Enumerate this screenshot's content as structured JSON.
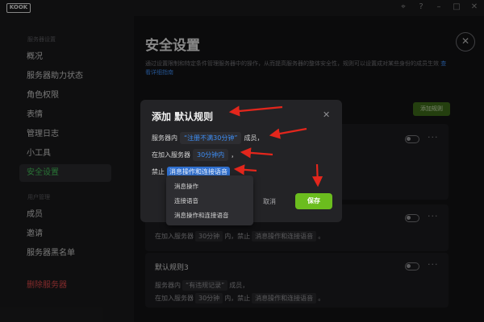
{
  "app": {
    "logo_text": "KOOK",
    "window_icons": [
      "pin-icon",
      "help-icon",
      "minimize-icon",
      "maximize-icon",
      "close-icon"
    ]
  },
  "sidebar": {
    "section_server_settings": "服务器设置",
    "items_top": [
      {
        "label": "概况"
      },
      {
        "label": "服务器助力状态"
      },
      {
        "label": "角色权限"
      },
      {
        "label": "表情"
      },
      {
        "label": "管理日志"
      },
      {
        "label": "小工具"
      },
      {
        "label": "安全设置",
        "active": true
      }
    ],
    "section_user_management": "用户管理",
    "items_bottom": [
      {
        "label": "成员"
      },
      {
        "label": "邀请"
      },
      {
        "label": "服务器黑名单"
      }
    ],
    "delete_server": "删除服务器"
  },
  "main": {
    "title": "安全设置",
    "description": "通过设置限制和特定条件管理服务器中的操作，从而提高服务器的整体安全性，规则可以设置成对某些身份的成员生效",
    "description_link": "查看详细指南",
    "add_rule_button": "添加规则",
    "rule_card_3": {
      "title": "默认规则3",
      "line1_prefix": "服务器内",
      "line1_pill": "“有违规记录”",
      "line1_suffix": "成员，",
      "line2_prefix": "在加入服务器",
      "line2_pill1": "30分钟",
      "line2_mid": "内，禁止",
      "line2_pill2": "消息操作和连接语音",
      "line2_suffix": "。"
    },
    "rule_card_2_partial": {
      "line2_prefix": "在加入服务器",
      "line2_pill1": "30分钟",
      "line2_mid": "内，禁止",
      "line2_pill2": "消息操作和连接语音",
      "line2_suffix": "。"
    }
  },
  "modal": {
    "title": "添加 默认规则",
    "line1_prefix": "服务器内",
    "line1_value": "“注册不满30分钟”",
    "line1_suffix": "成员，",
    "line2_prefix": "在加入服务器",
    "line2_value": "30分钟内",
    "line2_suffix": "，",
    "line3_prefix": "禁止",
    "line3_value": "消息操作和连接语音",
    "cancel_label": "取消",
    "save_label": "保存",
    "dropdown_options": [
      {
        "label": "消息操作"
      },
      {
        "label": "连接语音"
      },
      {
        "label": "消息操作和连接语音"
      }
    ]
  },
  "colors": {
    "accent_green": "#6bbd1e",
    "active_text_green": "#46c35a",
    "link_blue": "#3e8ef5",
    "danger_red": "#e0494a",
    "annotation_red": "#e3261c"
  }
}
